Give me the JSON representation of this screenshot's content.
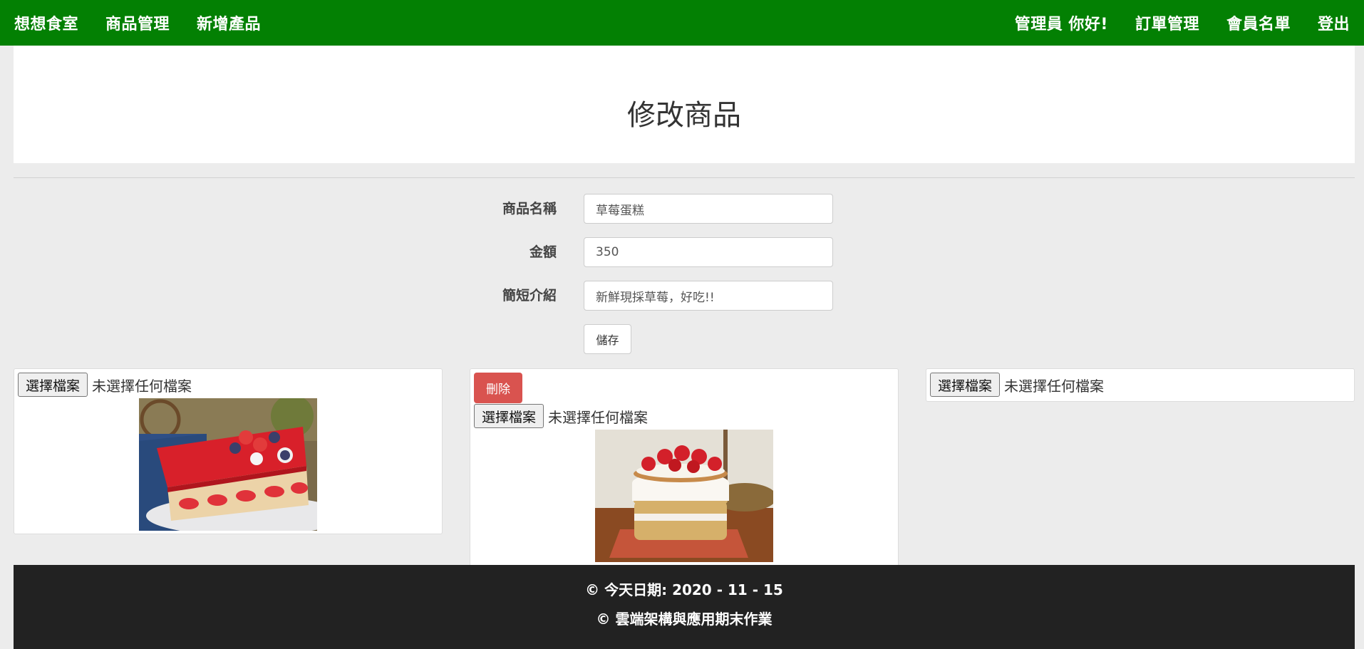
{
  "navbar": {
    "brand": "想想食室",
    "left_links": [
      "商品管理",
      "新增產品"
    ],
    "right_links": [
      "管理員 你好!",
      "訂單管理",
      "會員名單",
      "登出"
    ]
  },
  "page_title": "修改商品",
  "form": {
    "name_label": "商品名稱",
    "name_value": "草莓蛋糕",
    "price_label": "金額",
    "price_value": "350",
    "desc_label": "簡短介紹",
    "desc_value": "新鮮現採草莓，好吃!!",
    "save_label": "儲存"
  },
  "images": {
    "choose_file_label": "選擇檔案",
    "no_file_text": "未選擇任何檔案",
    "delete_label": "刪除"
  },
  "footer": {
    "date_line": "© 今天日期: 2020 - 11 - 15",
    "course_line": "© 雲端架構與應用期末作業"
  },
  "colors": {
    "navbar": "#038003",
    "delete": "#d9534f",
    "footer": "#222222",
    "background": "#ececec"
  }
}
